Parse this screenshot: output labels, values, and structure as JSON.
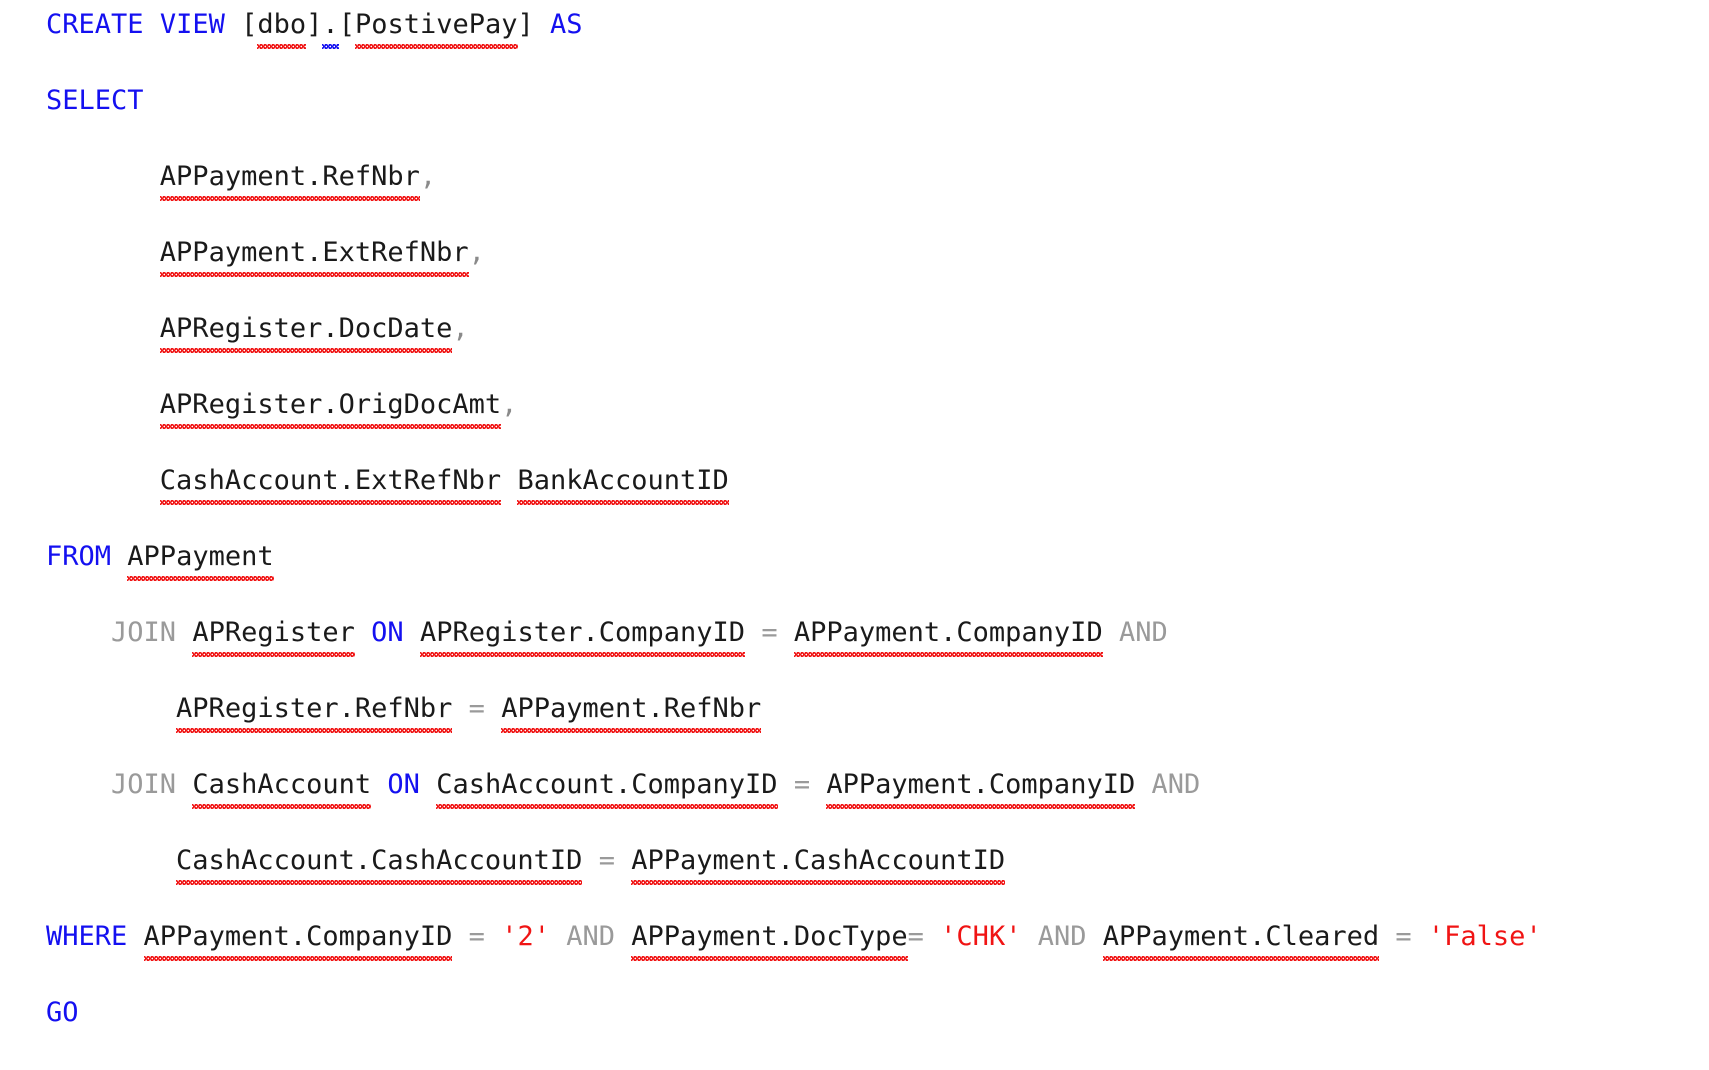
{
  "document": {
    "kind": "sql-source-code",
    "language": "T-SQL",
    "colors": {
      "background": "#ffffff",
      "keyword": "#1410f0",
      "keyword_dim": "#9a9a9a",
      "operator": "#9a9a9a",
      "string": "#f01414",
      "identifier": "#1a1a1a",
      "spellcheck_squiggle": "#f01414",
      "grammar_squiggle": "#1410f0"
    },
    "lines": [
      {
        "indent": 0,
        "tokens": [
          {
            "t": "CREATE",
            "c": "kw"
          },
          {
            "t": " ",
            "c": "plain"
          },
          {
            "t": "VIEW",
            "c": "kw"
          },
          {
            "t": " ",
            "c": "plain"
          },
          {
            "t": "[",
            "c": "brk"
          },
          {
            "t": "dbo",
            "c": "id",
            "squiggle": "red"
          },
          {
            "t": "]",
            "c": "brk"
          },
          {
            "t": ".",
            "c": "id",
            "squiggle": "blue"
          },
          {
            "t": "[",
            "c": "brk"
          },
          {
            "t": "PostivePay",
            "c": "id",
            "squiggle": "red"
          },
          {
            "t": "]",
            "c": "brk"
          },
          {
            "t": " ",
            "c": "plain"
          },
          {
            "t": "AS",
            "c": "kw"
          }
        ]
      },
      {
        "indent": 0,
        "tokens": [
          {
            "t": "SELECT",
            "c": "kw"
          }
        ]
      },
      {
        "indent": 7,
        "tokens": [
          {
            "t": "APPayment.RefNbr",
            "c": "id",
            "squiggle": "red"
          },
          {
            "t": ",",
            "c": "punct"
          }
        ]
      },
      {
        "indent": 7,
        "tokens": [
          {
            "t": "APPayment.ExtRefNbr",
            "c": "id",
            "squiggle": "red"
          },
          {
            "t": ",",
            "c": "punct"
          }
        ]
      },
      {
        "indent": 7,
        "tokens": [
          {
            "t": "APRegister.DocDate",
            "c": "id",
            "squiggle": "red"
          },
          {
            "t": ",",
            "c": "punct"
          }
        ]
      },
      {
        "indent": 7,
        "tokens": [
          {
            "t": "APRegister.OrigDocAmt",
            "c": "id",
            "squiggle": "red"
          },
          {
            "t": ",",
            "c": "punct"
          }
        ]
      },
      {
        "indent": 7,
        "tokens": [
          {
            "t": "CashAccount.ExtRefNbr",
            "c": "id",
            "squiggle": "red"
          },
          {
            "t": " ",
            "c": "plain"
          },
          {
            "t": "BankAccountID",
            "c": "id",
            "squiggle": "red"
          }
        ]
      },
      {
        "indent": 0,
        "tokens": [
          {
            "t": "FROM",
            "c": "kw"
          },
          {
            "t": " ",
            "c": "plain"
          },
          {
            "t": "APPayment",
            "c": "id",
            "squiggle": "red"
          }
        ]
      },
      {
        "indent": 4,
        "tokens": [
          {
            "t": "JOIN",
            "c": "kw-dim"
          },
          {
            "t": " ",
            "c": "plain"
          },
          {
            "t": "APRegister",
            "c": "id",
            "squiggle": "red"
          },
          {
            "t": " ",
            "c": "plain"
          },
          {
            "t": "ON",
            "c": "kw"
          },
          {
            "t": " ",
            "c": "plain"
          },
          {
            "t": "APRegister.CompanyID",
            "c": "id",
            "squiggle": "red"
          },
          {
            "t": " ",
            "c": "plain"
          },
          {
            "t": "=",
            "c": "op"
          },
          {
            "t": " ",
            "c": "plain"
          },
          {
            "t": "APPayment.CompanyID",
            "c": "id",
            "squiggle": "red"
          },
          {
            "t": " ",
            "c": "plain"
          },
          {
            "t": "AND",
            "c": "kw-dim"
          }
        ]
      },
      {
        "indent": 8,
        "tokens": [
          {
            "t": "APRegister.RefNbr",
            "c": "id",
            "squiggle": "red"
          },
          {
            "t": " ",
            "c": "plain"
          },
          {
            "t": "=",
            "c": "op"
          },
          {
            "t": " ",
            "c": "plain"
          },
          {
            "t": "APPayment.RefNbr",
            "c": "id",
            "squiggle": "red"
          }
        ]
      },
      {
        "indent": 4,
        "tokens": [
          {
            "t": "JOIN",
            "c": "kw-dim"
          },
          {
            "t": " ",
            "c": "plain"
          },
          {
            "t": "CashAccount",
            "c": "id",
            "squiggle": "red"
          },
          {
            "t": " ",
            "c": "plain"
          },
          {
            "t": "ON",
            "c": "kw"
          },
          {
            "t": " ",
            "c": "plain"
          },
          {
            "t": "CashAccount.CompanyID",
            "c": "id",
            "squiggle": "red"
          },
          {
            "t": " ",
            "c": "plain"
          },
          {
            "t": "=",
            "c": "op"
          },
          {
            "t": " ",
            "c": "plain"
          },
          {
            "t": "APPayment.CompanyID",
            "c": "id",
            "squiggle": "red"
          },
          {
            "t": " ",
            "c": "plain"
          },
          {
            "t": "AND",
            "c": "kw-dim"
          }
        ]
      },
      {
        "indent": 8,
        "tokens": [
          {
            "t": "CashAccount.CashAccountID",
            "c": "id",
            "squiggle": "red"
          },
          {
            "t": " ",
            "c": "plain"
          },
          {
            "t": "=",
            "c": "op"
          },
          {
            "t": " ",
            "c": "plain"
          },
          {
            "t": "APPayment.CashAccountID",
            "c": "id",
            "squiggle": "red"
          }
        ]
      },
      {
        "indent": 0,
        "tokens": [
          {
            "t": "WHERE",
            "c": "kw"
          },
          {
            "t": " ",
            "c": "plain"
          },
          {
            "t": "APPayment.CompanyID",
            "c": "id",
            "squiggle": "red"
          },
          {
            "t": " ",
            "c": "plain"
          },
          {
            "t": "=",
            "c": "op"
          },
          {
            "t": " ",
            "c": "plain"
          },
          {
            "t": "'2'",
            "c": "str"
          },
          {
            "t": " ",
            "c": "plain"
          },
          {
            "t": "AND",
            "c": "kw-dim"
          },
          {
            "t": " ",
            "c": "plain"
          },
          {
            "t": "APPayment.DocType",
            "c": "id",
            "squiggle": "red"
          },
          {
            "t": "=",
            "c": "op"
          },
          {
            "t": " ",
            "c": "plain"
          },
          {
            "t": "'CHK'",
            "c": "str"
          },
          {
            "t": " ",
            "c": "plain"
          },
          {
            "t": "AND",
            "c": "kw-dim"
          },
          {
            "t": " ",
            "c": "plain"
          },
          {
            "t": "APPayment.Cleared",
            "c": "id",
            "squiggle": "red"
          },
          {
            "t": " ",
            "c": "plain"
          },
          {
            "t": "=",
            "c": "op"
          },
          {
            "t": " ",
            "c": "plain"
          },
          {
            "t": "'False'",
            "c": "str"
          }
        ]
      },
      {
        "indent": 0,
        "tokens": [
          {
            "t": "GO",
            "c": "kw"
          }
        ]
      }
    ]
  }
}
